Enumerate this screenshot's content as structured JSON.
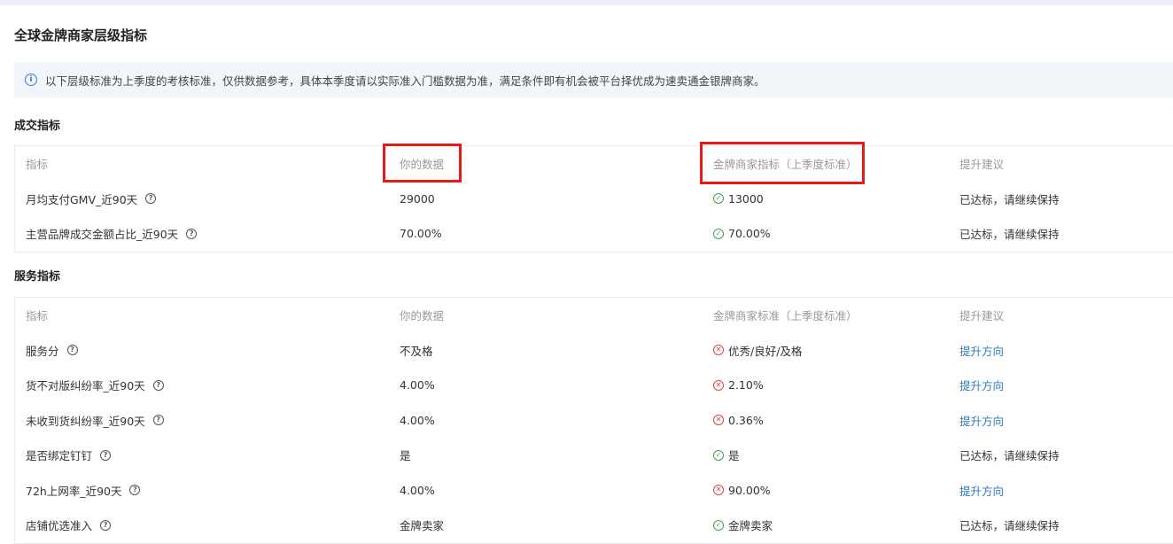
{
  "page": {
    "title": "全球金牌商家层级指标",
    "notice": "以下层级标准为上季度的考核标准，仅供数据参考，具体本季度请以实际准入门槛数据为准，满足条件即有机会被平台择优成为速卖通金银牌商家。"
  },
  "transaction": {
    "section_title": "成交指标",
    "headers": [
      "指标",
      "你的数据",
      "金牌商家指标（上季度标准）",
      "提升建议"
    ],
    "rows": [
      {
        "metric": "月均支付GMV_近90天",
        "yours": "29000",
        "status": "ok",
        "standard": "13000",
        "advice": "已达标，请继续保持",
        "advice_link": false
      },
      {
        "metric": "主营品牌成交金额占比_近90天",
        "yours": "70.00%",
        "status": "ok",
        "standard": "70.00%",
        "advice": "已达标，请继续保持",
        "advice_link": false
      }
    ]
  },
  "service": {
    "section_title": "服务指标",
    "headers": [
      "指标",
      "你的数据",
      "金牌商家标准（上季度标准）",
      "提升建议"
    ],
    "rows": [
      {
        "metric": "服务分",
        "yours": "不及格",
        "status": "bad",
        "standard": "优秀/良好/及格",
        "advice": "提升方向",
        "advice_link": true
      },
      {
        "metric": "货不对版纠纷率_近90天",
        "yours": "4.00%",
        "status": "bad",
        "standard": "2.10%",
        "advice": "提升方向",
        "advice_link": true
      },
      {
        "metric": "未收到货纠纷率_近90天",
        "yours": "4.00%",
        "status": "bad",
        "standard": "0.36%",
        "advice": "提升方向",
        "advice_link": true
      },
      {
        "metric": "是否绑定钉钉",
        "yours": "是",
        "status": "ok",
        "standard": "是",
        "advice": "已达标，请继续保持",
        "advice_link": false
      },
      {
        "metric": "72h上网率_近90天",
        "yours": "4.00%",
        "status": "bad",
        "standard": "90.00%",
        "advice": "提升方向",
        "advice_link": true
      },
      {
        "metric": "店铺优选准入",
        "yours": "金牌卖家",
        "status": "ok",
        "standard": "金牌卖家",
        "advice": "已达标，请继续保持",
        "advice_link": false
      }
    ]
  },
  "icons": {
    "info": "info-icon",
    "help": "help-circle-icon",
    "ok": "check-circle-icon",
    "bad": "x-circle-icon"
  },
  "colors": {
    "ok": "#3aa55a",
    "bad": "#e0463e",
    "link": "#2e7bbf",
    "highlight": "#e61a1a",
    "info": "#2f7bd9"
  }
}
